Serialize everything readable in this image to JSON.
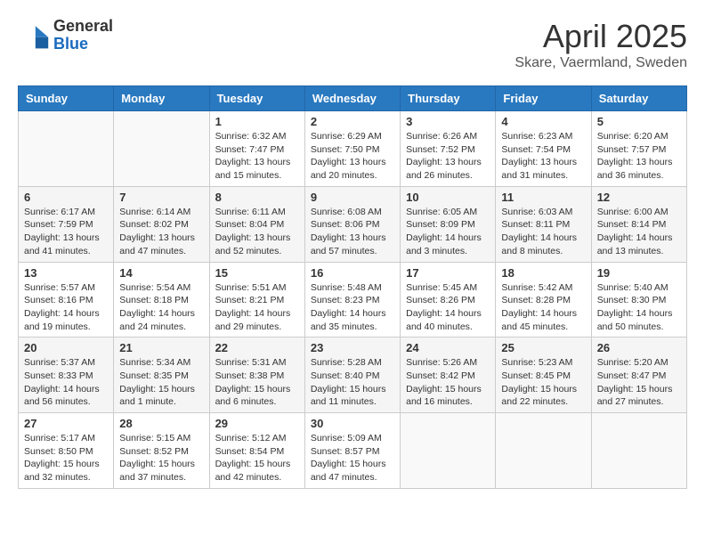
{
  "header": {
    "logo_line1": "General",
    "logo_line2": "Blue",
    "month_title": "April 2025",
    "subtitle": "Skare, Vaermland, Sweden"
  },
  "days_of_week": [
    "Sunday",
    "Monday",
    "Tuesday",
    "Wednesday",
    "Thursday",
    "Friday",
    "Saturday"
  ],
  "weeks": [
    [
      {
        "day": "",
        "info": ""
      },
      {
        "day": "",
        "info": ""
      },
      {
        "day": "1",
        "info": "Sunrise: 6:32 AM\nSunset: 7:47 PM\nDaylight: 13 hours and 15 minutes."
      },
      {
        "day": "2",
        "info": "Sunrise: 6:29 AM\nSunset: 7:50 PM\nDaylight: 13 hours and 20 minutes."
      },
      {
        "day": "3",
        "info": "Sunrise: 6:26 AM\nSunset: 7:52 PM\nDaylight: 13 hours and 26 minutes."
      },
      {
        "day": "4",
        "info": "Sunrise: 6:23 AM\nSunset: 7:54 PM\nDaylight: 13 hours and 31 minutes."
      },
      {
        "day": "5",
        "info": "Sunrise: 6:20 AM\nSunset: 7:57 PM\nDaylight: 13 hours and 36 minutes."
      }
    ],
    [
      {
        "day": "6",
        "info": "Sunrise: 6:17 AM\nSunset: 7:59 PM\nDaylight: 13 hours and 41 minutes."
      },
      {
        "day": "7",
        "info": "Sunrise: 6:14 AM\nSunset: 8:02 PM\nDaylight: 13 hours and 47 minutes."
      },
      {
        "day": "8",
        "info": "Sunrise: 6:11 AM\nSunset: 8:04 PM\nDaylight: 13 hours and 52 minutes."
      },
      {
        "day": "9",
        "info": "Sunrise: 6:08 AM\nSunset: 8:06 PM\nDaylight: 13 hours and 57 minutes."
      },
      {
        "day": "10",
        "info": "Sunrise: 6:05 AM\nSunset: 8:09 PM\nDaylight: 14 hours and 3 minutes."
      },
      {
        "day": "11",
        "info": "Sunrise: 6:03 AM\nSunset: 8:11 PM\nDaylight: 14 hours and 8 minutes."
      },
      {
        "day": "12",
        "info": "Sunrise: 6:00 AM\nSunset: 8:14 PM\nDaylight: 14 hours and 13 minutes."
      }
    ],
    [
      {
        "day": "13",
        "info": "Sunrise: 5:57 AM\nSunset: 8:16 PM\nDaylight: 14 hours and 19 minutes."
      },
      {
        "day": "14",
        "info": "Sunrise: 5:54 AM\nSunset: 8:18 PM\nDaylight: 14 hours and 24 minutes."
      },
      {
        "day": "15",
        "info": "Sunrise: 5:51 AM\nSunset: 8:21 PM\nDaylight: 14 hours and 29 minutes."
      },
      {
        "day": "16",
        "info": "Sunrise: 5:48 AM\nSunset: 8:23 PM\nDaylight: 14 hours and 35 minutes."
      },
      {
        "day": "17",
        "info": "Sunrise: 5:45 AM\nSunset: 8:26 PM\nDaylight: 14 hours and 40 minutes."
      },
      {
        "day": "18",
        "info": "Sunrise: 5:42 AM\nSunset: 8:28 PM\nDaylight: 14 hours and 45 minutes."
      },
      {
        "day": "19",
        "info": "Sunrise: 5:40 AM\nSunset: 8:30 PM\nDaylight: 14 hours and 50 minutes."
      }
    ],
    [
      {
        "day": "20",
        "info": "Sunrise: 5:37 AM\nSunset: 8:33 PM\nDaylight: 14 hours and 56 minutes."
      },
      {
        "day": "21",
        "info": "Sunrise: 5:34 AM\nSunset: 8:35 PM\nDaylight: 15 hours and 1 minute."
      },
      {
        "day": "22",
        "info": "Sunrise: 5:31 AM\nSunset: 8:38 PM\nDaylight: 15 hours and 6 minutes."
      },
      {
        "day": "23",
        "info": "Sunrise: 5:28 AM\nSunset: 8:40 PM\nDaylight: 15 hours and 11 minutes."
      },
      {
        "day": "24",
        "info": "Sunrise: 5:26 AM\nSunset: 8:42 PM\nDaylight: 15 hours and 16 minutes."
      },
      {
        "day": "25",
        "info": "Sunrise: 5:23 AM\nSunset: 8:45 PM\nDaylight: 15 hours and 22 minutes."
      },
      {
        "day": "26",
        "info": "Sunrise: 5:20 AM\nSunset: 8:47 PM\nDaylight: 15 hours and 27 minutes."
      }
    ],
    [
      {
        "day": "27",
        "info": "Sunrise: 5:17 AM\nSunset: 8:50 PM\nDaylight: 15 hours and 32 minutes."
      },
      {
        "day": "28",
        "info": "Sunrise: 5:15 AM\nSunset: 8:52 PM\nDaylight: 15 hours and 37 minutes."
      },
      {
        "day": "29",
        "info": "Sunrise: 5:12 AM\nSunset: 8:54 PM\nDaylight: 15 hours and 42 minutes."
      },
      {
        "day": "30",
        "info": "Sunrise: 5:09 AM\nSunset: 8:57 PM\nDaylight: 15 hours and 47 minutes."
      },
      {
        "day": "",
        "info": ""
      },
      {
        "day": "",
        "info": ""
      },
      {
        "day": "",
        "info": ""
      }
    ]
  ]
}
